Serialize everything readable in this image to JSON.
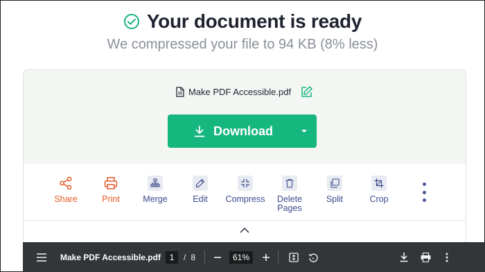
{
  "header": {
    "title": "Your document is ready",
    "subtitle": "We compressed your file to 94 KB (8% less)"
  },
  "file": {
    "name": "Make PDF Accessible.pdf"
  },
  "download": {
    "label": "Download",
    "color": "#16b67f"
  },
  "tools": [
    {
      "label": "Share",
      "icon": "share-icon"
    },
    {
      "label": "Print",
      "icon": "print-icon"
    },
    {
      "label": "Merge",
      "icon": "merge-icon"
    },
    {
      "label": "Edit",
      "icon": "pencil-icon"
    },
    {
      "label": "Compress",
      "icon": "compress-icon"
    },
    {
      "label": "Delete Pages",
      "icon": "trash-icon"
    },
    {
      "label": "Split",
      "icon": "split-icon"
    },
    {
      "label": "Crop",
      "icon": "crop-icon"
    }
  ],
  "viewer": {
    "title": "Make PDF Accessible.pdf",
    "current_page": "1",
    "page_separator": "/",
    "total_pages": "8",
    "zoom": "61%"
  },
  "colors": {
    "accent_green": "#16b67f",
    "accent_orange": "#e25a26",
    "tool_blue": "#3d4a8c",
    "viewer_bg": "#323639"
  }
}
